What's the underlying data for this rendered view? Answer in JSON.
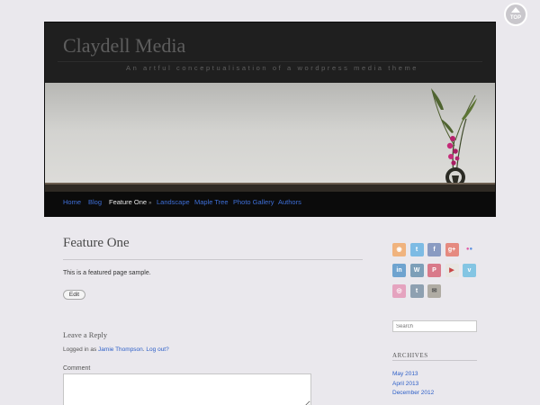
{
  "top_button": {
    "label": "TOP"
  },
  "site": {
    "title": "Claydell Media",
    "tagline": "An artful conceptualisation of a wordpress media theme"
  },
  "nav": {
    "items": [
      {
        "label": "Home",
        "active": false
      },
      {
        "label": "Blog",
        "active": false
      },
      {
        "label": "Feature One",
        "active": true,
        "has_children": true
      },
      {
        "label": "Landscape",
        "active": false
      },
      {
        "label": "Maple Tree",
        "active": false
      },
      {
        "label": "Photo Gallery",
        "active": false
      },
      {
        "label": "Authors",
        "active": false
      }
    ],
    "caret": "»"
  },
  "page": {
    "title": "Feature One",
    "body": "This is a featured page sample.",
    "edit_label": "Edit"
  },
  "comments": {
    "reply_title": "Leave a Reply",
    "logged_prefix": "Logged in as",
    "user": "Jamie Thompson",
    "logout": "Log out?",
    "comment_label": "Comment"
  },
  "sidebar": {
    "social_icons": [
      {
        "name": "rss-icon",
        "glyph": "◉",
        "color": "#f0b37e"
      },
      {
        "name": "twitter-icon",
        "glyph": "t",
        "color": "#7dbbe4"
      },
      {
        "name": "facebook-icon",
        "glyph": "f",
        "color": "#8a9bc2"
      },
      {
        "name": "google-plus-icon",
        "glyph": "g+",
        "color": "#e58a80"
      },
      {
        "name": "flickr-icon",
        "glyph": "●●",
        "color": "transparent"
      },
      {
        "name": "linkedin-icon",
        "glyph": "in",
        "color": "#6fa3cf"
      },
      {
        "name": "wordpress-icon",
        "glyph": "W",
        "color": "#7d9fb8"
      },
      {
        "name": "pinterest-icon",
        "glyph": "P",
        "color": "#d97a8a"
      },
      {
        "name": "youtube-icon",
        "glyph": "▶",
        "color": "#e8e6e2"
      },
      {
        "name": "vimeo-icon",
        "glyph": "v",
        "color": "#84c5e3"
      },
      {
        "name": "dribbble-icon",
        "glyph": "◎",
        "color": "#e5a3bf"
      },
      {
        "name": "tumblr-icon",
        "glyph": "t",
        "color": "#8ea0b1"
      },
      {
        "name": "email-icon",
        "glyph": "✉",
        "color": "#b0aca4"
      }
    ],
    "search_placeholder": "Search",
    "archives_title": "ARCHIVES",
    "archives": [
      "May 2013",
      "April 2013",
      "December 2012"
    ]
  }
}
